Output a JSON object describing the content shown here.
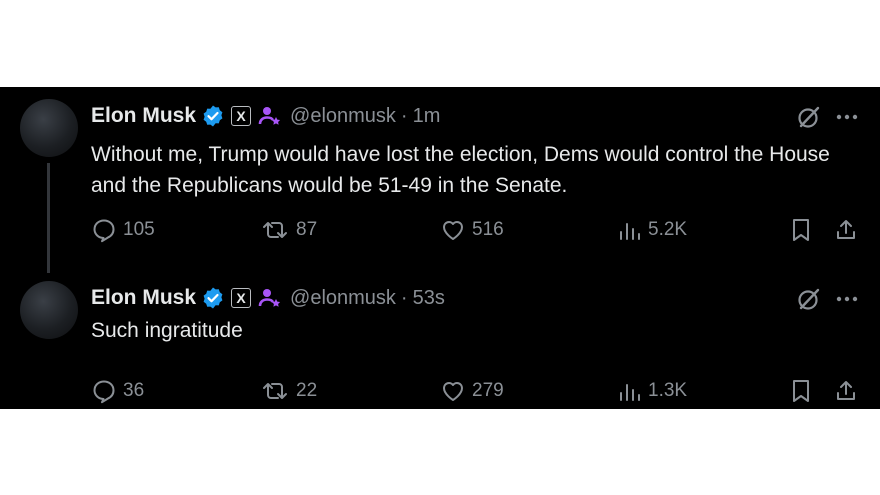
{
  "tweets": [
    {
      "author": "Elon Musk",
      "handle": "@elonmusk",
      "separator": "·",
      "time": "1m",
      "text": "Without me, Trump would have lost the election, Dems would control the House and the Republicans would be 51-49 in the Senate.",
      "replies": "105",
      "reposts": "87",
      "likes": "516",
      "views": "5.2K"
    },
    {
      "author": "Elon Musk",
      "handle": "@elonmusk",
      "separator": "·",
      "time": "53s",
      "text": "Such ingratitude",
      "replies": "36",
      "reposts": "22",
      "likes": "279",
      "views": "1.3K"
    }
  ],
  "badges": {
    "x_badge_glyph": "X"
  },
  "colors": {
    "background": "#000000",
    "text": "#e7e9ea",
    "muted": "#8b9096",
    "verified": "#1d9bf0",
    "persona": "#a855f7"
  },
  "icons": [
    "verified-badge-icon",
    "x-badge-icon",
    "persona-icon",
    "grok-icon",
    "more-icon",
    "reply-icon",
    "repost-icon",
    "like-icon",
    "views-icon",
    "bookmark-icon",
    "share-icon"
  ]
}
